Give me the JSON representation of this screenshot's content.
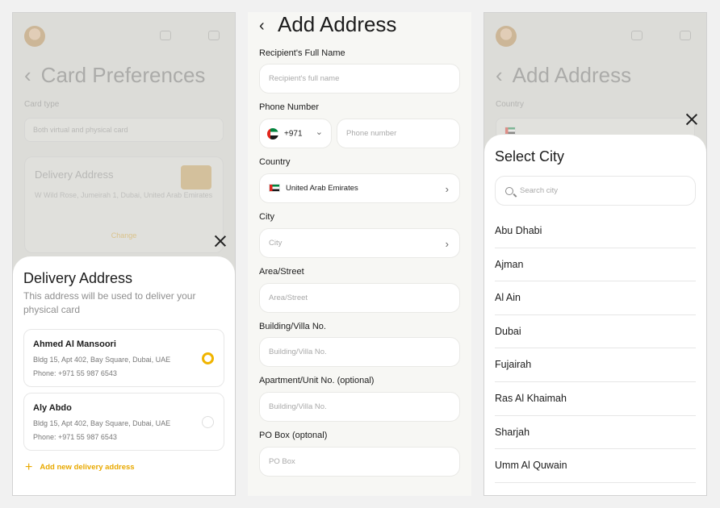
{
  "screen1": {
    "background": {
      "title": "Card Preferences",
      "card_type_label": "Card type",
      "card_type_value": "Both virtual and physical card",
      "delivery_title": "Delivery Address",
      "delivery_text": "W Wild Rose, Jumeirah 1, Dubai, United Arab Emirates",
      "change_label": "Change"
    },
    "sheet": {
      "title": "Delivery Address",
      "subtitle": "This address will be used to deliver your physical card",
      "addresses": [
        {
          "name": "Ahmed Al Mansoori",
          "address": "Bldg 15, Apt 402, Bay Square, Dubai, UAE",
          "phone": "Phone: +971 55 987 6543",
          "selected": true
        },
        {
          "name": "Aly Abdo",
          "address": "Bldg 15, Apt 402, Bay Square, Dubai, UAE",
          "phone": "Phone: +971 55 987 6543",
          "selected": false
        }
      ],
      "add_label": "Add new delivery address"
    }
  },
  "screen2": {
    "title": "Add Address",
    "fields": {
      "name_label": "Recipient's Full Name",
      "name_placeholder": "Recipient's full name",
      "phone_label": "Phone Number",
      "country_code": "+971",
      "phone_placeholder": "Phone number",
      "country_label": "Country",
      "country_value": "United Arab Emirates",
      "city_label": "City",
      "city_placeholder": "City",
      "area_label": "Area/Street",
      "area_placeholder": "Area/Street",
      "building_label": "Building/Villa No.",
      "building_placeholder": "Building/Villa No.",
      "apartment_label": "Apartment/Unit No. (optional)",
      "apartment_placeholder": "Building/Villa No.",
      "pobox_label": "PO Box (optonal)",
      "pobox_placeholder": "PO Box"
    }
  },
  "screen3": {
    "background": {
      "title": "Add Address",
      "country_label": "Country"
    },
    "sheet": {
      "title": "Select City",
      "search_placeholder": "Search city",
      "cities": [
        "Abu Dhabi",
        "Ajman",
        "Al Ain",
        "Dubai",
        "Fujairah",
        "Ras Al Khaimah",
        "Sharjah",
        "Umm Al Quwain"
      ]
    }
  },
  "colors": {
    "accent": "#f0b400",
    "dim_background": "#dcdcd8",
    "sheet": "#ffffff"
  }
}
